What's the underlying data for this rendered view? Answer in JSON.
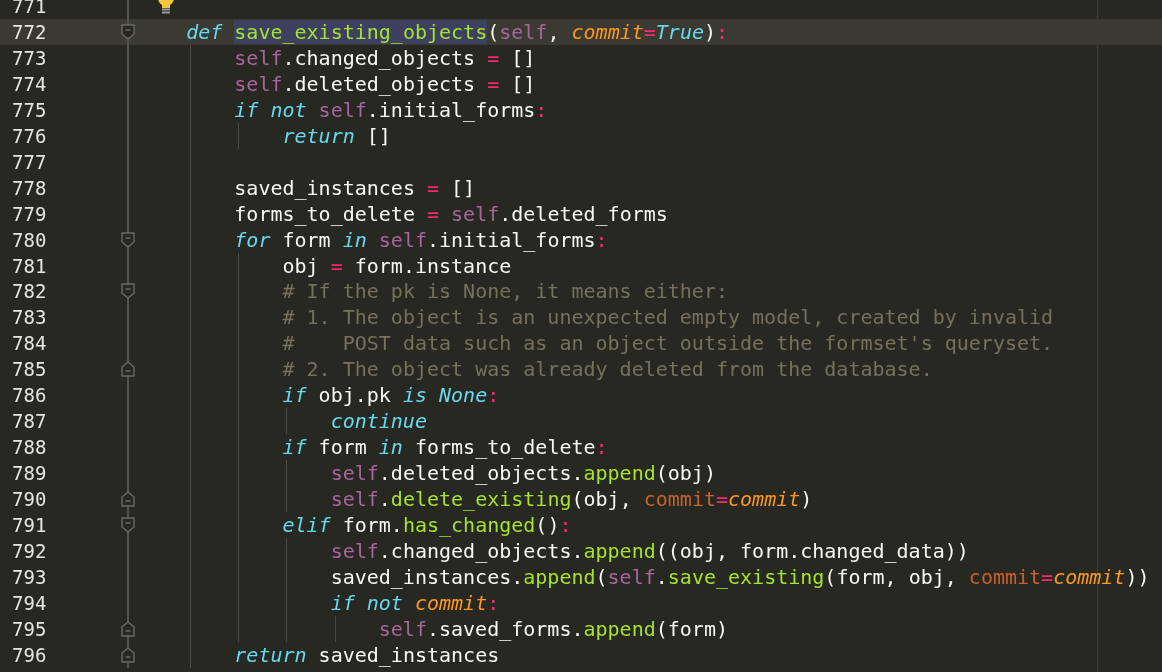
{
  "editor": {
    "lines": [
      {
        "number": "771",
        "current": false,
        "hint": true
      },
      {
        "number": "772",
        "current": true,
        "fold_start": true,
        "tokens": [
          {
            "kind": "kw",
            "text": "def "
          },
          {
            "kind": "fn",
            "text": "save_existing_objects",
            "highlighted": true
          },
          {
            "kind": "text",
            "text": "("
          },
          {
            "kind": "self",
            "text": "self"
          },
          {
            "kind": "text",
            "text": ", "
          },
          {
            "kind": "param",
            "text": "commit"
          },
          {
            "kind": "op",
            "text": "="
          },
          {
            "kind": "const",
            "text": "True"
          },
          {
            "kind": "text",
            "text": ")"
          },
          {
            "kind": "op",
            "text": ":"
          }
        ],
        "children": [
          {
            "number": "773",
            "current": false,
            "tokens": [
              {
                "kind": "self",
                "text": "self"
              },
              {
                "kind": "text",
                "text": ".changed_objects "
              },
              {
                "kind": "op",
                "text": "="
              },
              {
                "kind": "text",
                "text": " []"
              }
            ]
          },
          {
            "number": "774",
            "current": false,
            "tokens": [
              {
                "kind": "self",
                "text": "self"
              },
              {
                "kind": "text",
                "text": ".deleted_objects "
              },
              {
                "kind": "op",
                "text": "="
              },
              {
                "kind": "text",
                "text": " []"
              }
            ]
          },
          {
            "number": "775",
            "current": false,
            "tokens": [
              {
                "kind": "kw",
                "text": "if not "
              },
              {
                "kind": "self",
                "text": "self"
              },
              {
                "kind": "text",
                "text": ".initial_forms"
              },
              {
                "kind": "op",
                "text": ":"
              }
            ],
            "children": [
              {
                "number": "776",
                "current": false,
                "tokens": [
                  {
                    "kind": "kw",
                    "text": "return"
                  },
                  {
                    "kind": "text",
                    "text": " []"
                  }
                ]
              }
            ]
          },
          {
            "number": "777",
            "current": false
          },
          {
            "number": "778",
            "current": false,
            "tokens": [
              {
                "kind": "text",
                "text": "saved_instances "
              },
              {
                "kind": "op",
                "text": "="
              },
              {
                "kind": "text",
                "text": " []"
              }
            ]
          },
          {
            "number": "779",
            "current": false,
            "tokens": [
              {
                "kind": "text",
                "text": "forms_to_delete "
              },
              {
                "kind": "op",
                "text": "= "
              },
              {
                "kind": "self",
                "text": "self"
              },
              {
                "kind": "text",
                "text": ".deleted_forms"
              }
            ]
          },
          {
            "number": "780",
            "current": false,
            "fold_start": true,
            "tokens": [
              {
                "kind": "kw",
                "text": "for"
              },
              {
                "kind": "text",
                "text": " form "
              },
              {
                "kind": "kw",
                "text": "in "
              },
              {
                "kind": "self",
                "text": "self"
              },
              {
                "kind": "text",
                "text": ".initial_forms"
              },
              {
                "kind": "op",
                "text": ":"
              }
            ],
            "children": [
              {
                "number": "781",
                "current": false,
                "tokens": [
                  {
                    "kind": "text",
                    "text": "obj "
                  },
                  {
                    "kind": "op",
                    "text": "="
                  },
                  {
                    "kind": "text",
                    "text": " form.instance"
                  }
                ]
              },
              {
                "number": "782",
                "current": false,
                "fold_start": true,
                "tokens": [
                  {
                    "kind": "comment",
                    "text": "# If the pk is None, it means either:"
                  }
                ]
              },
              {
                "number": "783",
                "current": false,
                "tokens": [
                  {
                    "kind": "comment",
                    "text": "# 1. The object is an unexpected empty model, created by invalid"
                  }
                ]
              },
              {
                "number": "784",
                "current": false,
                "tokens": [
                  {
                    "kind": "comment",
                    "text": "#    POST data such as an object outside the formset's queryset."
                  }
                ]
              },
              {
                "number": "785",
                "current": false,
                "fold_end": true,
                "tokens": [
                  {
                    "kind": "comment",
                    "text": "# 2. The object was already deleted from the database."
                  }
                ]
              },
              {
                "number": "786",
                "current": false,
                "tokens": [
                  {
                    "kind": "kw",
                    "text": "if"
                  },
                  {
                    "kind": "text",
                    "text": " obj.pk "
                  },
                  {
                    "kind": "kw",
                    "text": "is "
                  },
                  {
                    "kind": "const",
                    "text": "None"
                  },
                  {
                    "kind": "op",
                    "text": ":"
                  }
                ],
                "children": [
                  {
                    "number": "787",
                    "current": false,
                    "tokens": [
                      {
                        "kind": "kw",
                        "text": "continue"
                      }
                    ]
                  }
                ]
              },
              {
                "number": "788",
                "current": false,
                "tokens": [
                  {
                    "kind": "kw",
                    "text": "if"
                  },
                  {
                    "kind": "text",
                    "text": " form "
                  },
                  {
                    "kind": "kw",
                    "text": "in"
                  },
                  {
                    "kind": "text",
                    "text": " forms_to_delete"
                  },
                  {
                    "kind": "op",
                    "text": ":"
                  }
                ],
                "children": [
                  {
                    "number": "789",
                    "current": false,
                    "tokens": [
                      {
                        "kind": "self",
                        "text": "self"
                      },
                      {
                        "kind": "text",
                        "text": ".deleted_objects."
                      },
                      {
                        "kind": "call",
                        "text": "append"
                      },
                      {
                        "kind": "text",
                        "text": "(obj)"
                      }
                    ]
                  },
                  {
                    "number": "790",
                    "current": false,
                    "fold_end": true,
                    "tokens": [
                      {
                        "kind": "self",
                        "text": "self"
                      },
                      {
                        "kind": "text",
                        "text": "."
                      },
                      {
                        "kind": "call",
                        "text": "delete_existing"
                      },
                      {
                        "kind": "text",
                        "text": "(obj, "
                      },
                      {
                        "kind": "kwarg",
                        "text": "commit"
                      },
                      {
                        "kind": "op",
                        "text": "="
                      },
                      {
                        "kind": "param",
                        "text": "commit"
                      },
                      {
                        "kind": "text",
                        "text": ")"
                      }
                    ]
                  }
                ]
              },
              {
                "number": "791",
                "current": false,
                "fold_start": true,
                "tokens": [
                  {
                    "kind": "kw",
                    "text": "elif"
                  },
                  {
                    "kind": "text",
                    "text": " form."
                  },
                  {
                    "kind": "call",
                    "text": "has_changed"
                  },
                  {
                    "kind": "text",
                    "text": "()"
                  },
                  {
                    "kind": "op",
                    "text": ":"
                  }
                ],
                "children": [
                  {
                    "number": "792",
                    "current": false,
                    "tokens": [
                      {
                        "kind": "self",
                        "text": "self"
                      },
                      {
                        "kind": "text",
                        "text": ".changed_objects."
                      },
                      {
                        "kind": "call",
                        "text": "append"
                      },
                      {
                        "kind": "text",
                        "text": "((obj, form.changed_data))"
                      }
                    ]
                  },
                  {
                    "number": "793",
                    "current": false,
                    "tokens": [
                      {
                        "kind": "text",
                        "text": "saved_instances."
                      },
                      {
                        "kind": "call",
                        "text": "append"
                      },
                      {
                        "kind": "text",
                        "text": "("
                      },
                      {
                        "kind": "self",
                        "text": "self"
                      },
                      {
                        "kind": "text",
                        "text": "."
                      },
                      {
                        "kind": "call",
                        "text": "save_existing"
                      },
                      {
                        "kind": "text",
                        "text": "(form, obj, "
                      },
                      {
                        "kind": "kwarg",
                        "text": "commit"
                      },
                      {
                        "kind": "op",
                        "text": "="
                      },
                      {
                        "kind": "param",
                        "text": "commit"
                      },
                      {
                        "kind": "text",
                        "text": "))"
                      }
                    ]
                  },
                  {
                    "number": "794",
                    "current": false,
                    "tokens": [
                      {
                        "kind": "kw",
                        "text": "if not "
                      },
                      {
                        "kind": "param",
                        "text": "commit"
                      },
                      {
                        "kind": "op",
                        "text": ":"
                      }
                    ],
                    "children": [
                      {
                        "number": "795",
                        "current": false,
                        "fold_end": true,
                        "tokens": [
                          {
                            "kind": "self",
                            "text": "self"
                          },
                          {
                            "kind": "text",
                            "text": ".saved_forms."
                          },
                          {
                            "kind": "call",
                            "text": "append"
                          },
                          {
                            "kind": "text",
                            "text": "(form)"
                          }
                        ]
                      }
                    ]
                  }
                ]
              }
            ]
          },
          {
            "number": "796",
            "current": false,
            "fold_end": true,
            "tokens": [
              {
                "kind": "kw",
                "text": "return"
              },
              {
                "kind": "text",
                "text": " saved_instances"
              }
            ]
          }
        ]
      }
    ]
  }
}
